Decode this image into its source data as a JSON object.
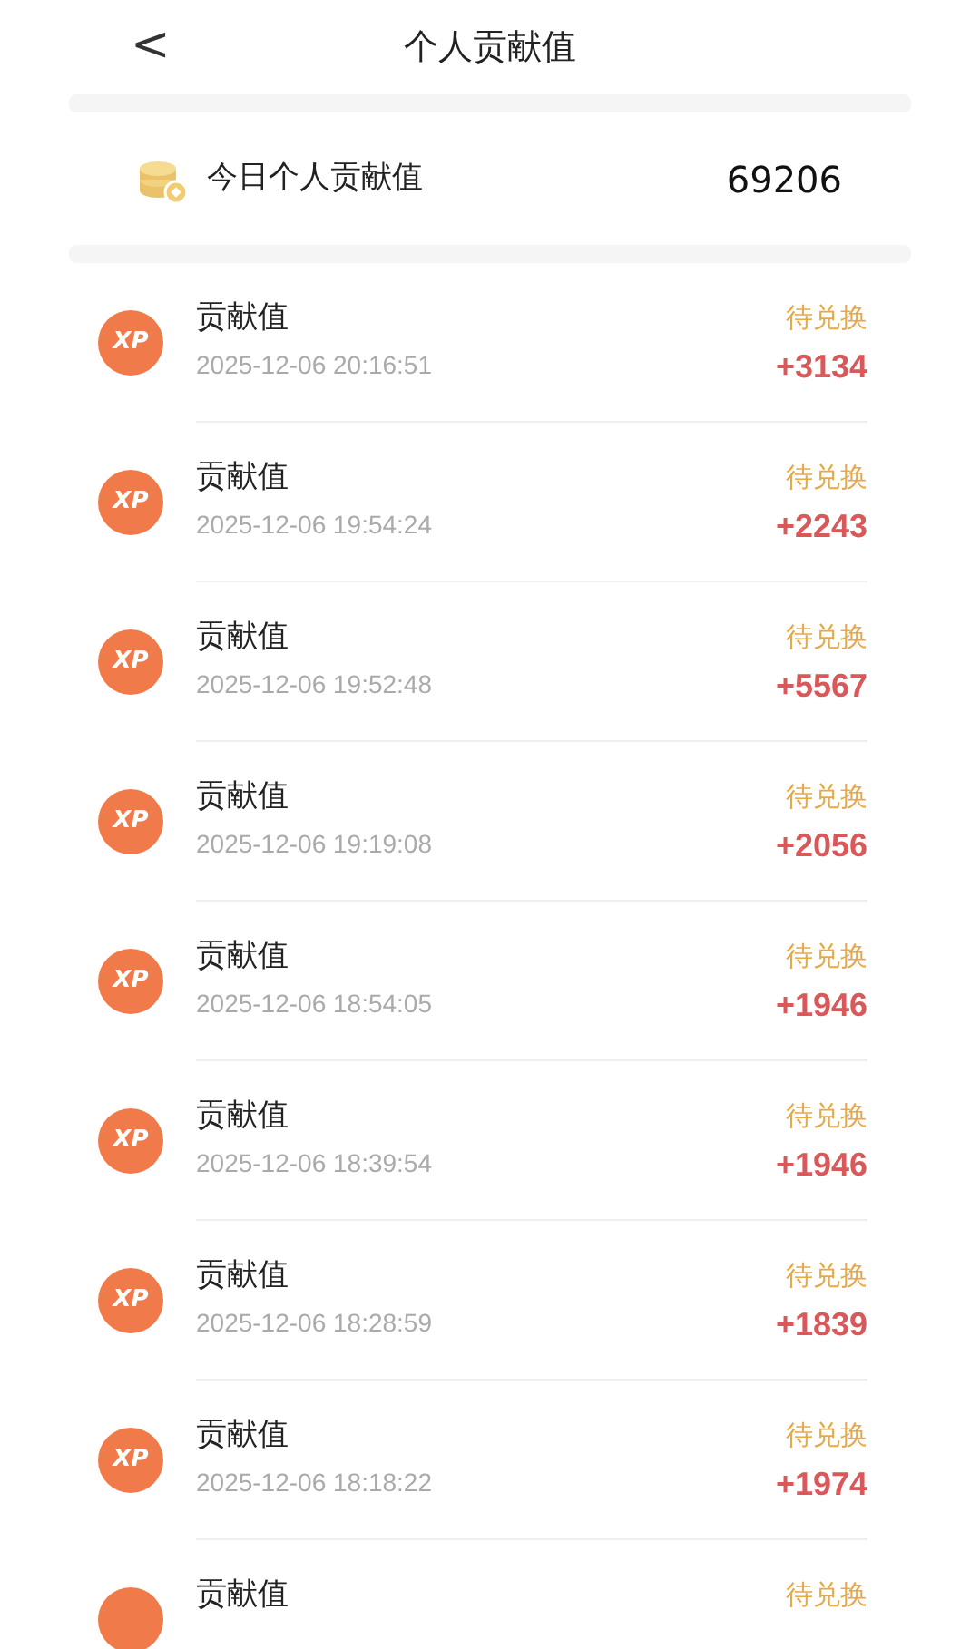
{
  "header": {
    "back": "<",
    "title": "个人贡献值"
  },
  "summary": {
    "label": "今日个人贡献值",
    "value": "69206"
  },
  "records": [
    {
      "icon_text": "XP",
      "title": "贡献值",
      "time": "2025-12-06 20:16:51",
      "status": "待兑换",
      "amount": "+3134"
    },
    {
      "icon_text": "XP",
      "title": "贡献值",
      "time": "2025-12-06 19:54:24",
      "status": "待兑换",
      "amount": "+2243"
    },
    {
      "icon_text": "XP",
      "title": "贡献值",
      "time": "2025-12-06 19:52:48",
      "status": "待兑换",
      "amount": "+5567"
    },
    {
      "icon_text": "XP",
      "title": "贡献值",
      "time": "2025-12-06 19:19:08",
      "status": "待兑换",
      "amount": "+2056"
    },
    {
      "icon_text": "XP",
      "title": "贡献值",
      "time": "2025-12-06 18:54:05",
      "status": "待兑换",
      "amount": "+1946"
    },
    {
      "icon_text": "XP",
      "title": "贡献值",
      "time": "2025-12-06 18:39:54",
      "status": "待兑换",
      "amount": "+1946"
    },
    {
      "icon_text": "XP",
      "title": "贡献值",
      "time": "2025-12-06 18:28:59",
      "status": "待兑换",
      "amount": "+1839"
    },
    {
      "icon_text": "XP",
      "title": "贡献值",
      "time": "2025-12-06 18:18:22",
      "status": "待兑换",
      "amount": "+1974"
    },
    {
      "title": "贡献值",
      "status": "待兑换"
    }
  ]
}
